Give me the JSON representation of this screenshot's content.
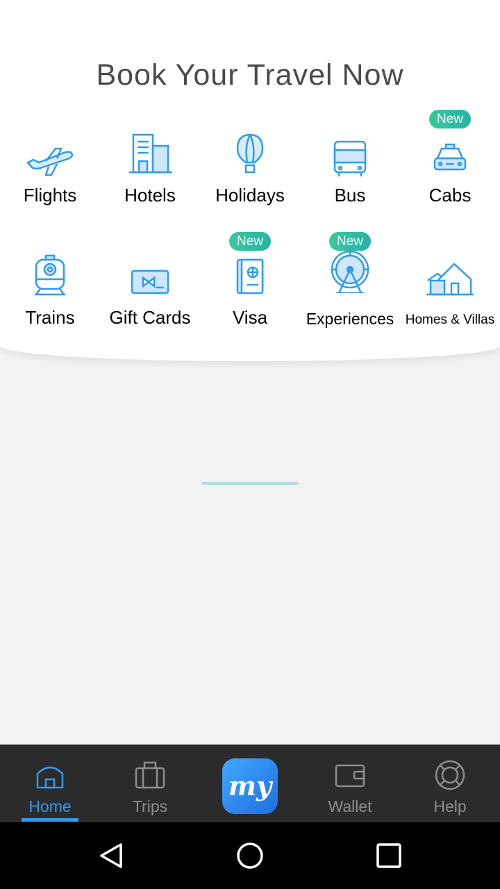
{
  "header": {
    "title": "Book Your Travel Now"
  },
  "services": {
    "row1": [
      {
        "label": "Flights",
        "icon": "airplane-icon"
      },
      {
        "label": "Hotels",
        "icon": "hotel-building-icon"
      },
      {
        "label": "Holidays",
        "icon": "hot-air-balloon-icon"
      },
      {
        "label": "Bus",
        "icon": "bus-icon"
      },
      {
        "label": "Cabs",
        "icon": "taxi-icon",
        "badge": "New"
      }
    ],
    "row2": [
      {
        "label": "Trains",
        "icon": "train-icon"
      },
      {
        "label": "Gift Cards",
        "icon": "gift-card-icon"
      },
      {
        "label": "Visa",
        "icon": "passport-icon",
        "badge": "New"
      },
      {
        "label": "Experiences",
        "icon": "ferris-wheel-icon",
        "badge": "New"
      },
      {
        "label": "Homes & Villas",
        "icon": "house-icon"
      }
    ]
  },
  "bottom_nav": {
    "items": [
      {
        "label": "Home",
        "icon": "home-icon",
        "active": true
      },
      {
        "label": "Trips",
        "icon": "briefcase-icon"
      },
      {
        "label": "my",
        "icon": "app-logo-icon"
      },
      {
        "label": "Wallet",
        "icon": "wallet-icon"
      },
      {
        "label": "Help",
        "icon": "lifebuoy-icon"
      }
    ]
  },
  "colors": {
    "accent": "#2f9bf0",
    "badge": "#2fbfa0",
    "nav_background": "#2b2b2b",
    "nav_inactive": "#8e8e8e"
  }
}
